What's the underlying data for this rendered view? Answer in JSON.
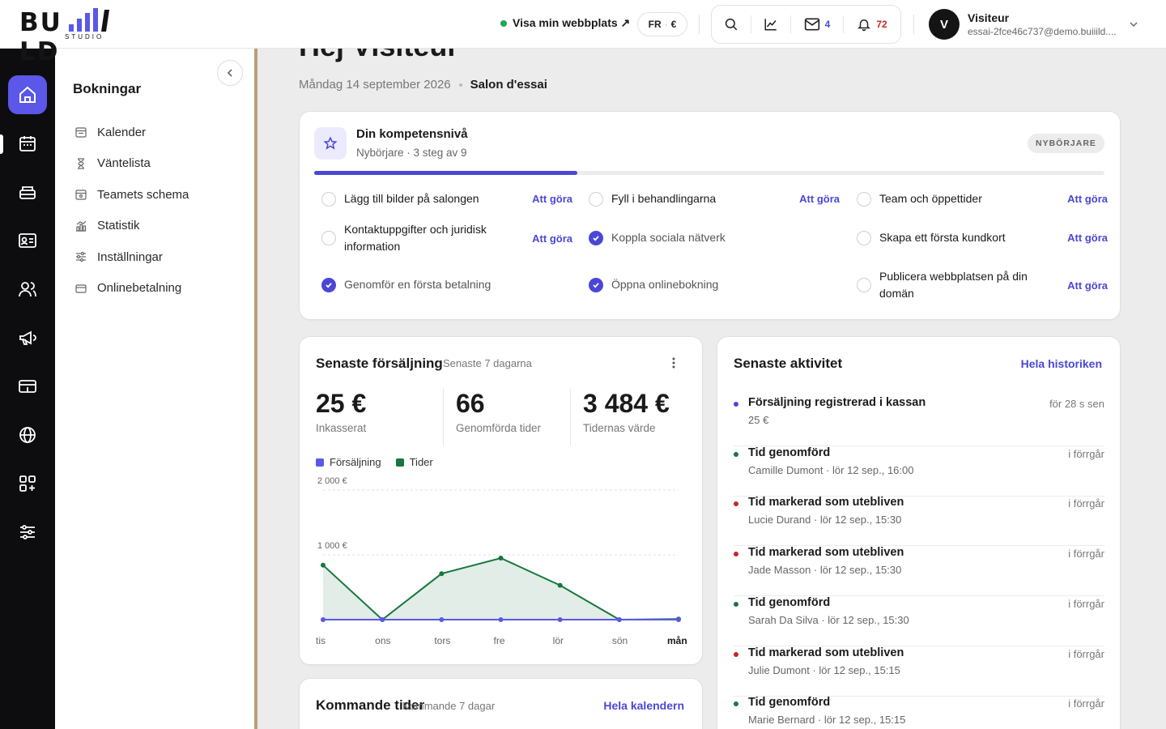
{
  "colors": {
    "accent": "#5b57e8",
    "progress": "#4b47d6",
    "sales_series": "#5b57e8",
    "appointments_series": "#17773f",
    "cancel_dot": "#c8242c",
    "ok_dot": "#17773f",
    "info_dot": "#4b47d6"
  },
  "logo": {
    "text": "BU LD",
    "subtext": "STUDIO"
  },
  "header": {
    "visit_label": "Visa min webbplats ↗",
    "lang": "FR",
    "currency": "€",
    "mail_count": "4",
    "notif_count": "72",
    "user_initial": "V",
    "user_name": "Visiteur",
    "user_email": "essai-2fce46c737@demo.buiiild...."
  },
  "rail": {
    "icons": [
      "home-icon",
      "calendar-icon",
      "register-icon",
      "contact-card-icon",
      "users-icon",
      "megaphone-icon",
      "payment-icon",
      "globe-icon",
      "apps-icon",
      "sliders-icon"
    ]
  },
  "submenu": {
    "title": "Bokningar",
    "items": [
      {
        "label": "Kalender",
        "icon": "calendar-small-icon"
      },
      {
        "label": "Väntelista",
        "icon": "hourglass-icon"
      },
      {
        "label": "Teamets schema",
        "icon": "team-schedule-icon"
      },
      {
        "label": "Statistik",
        "icon": "stats-icon"
      },
      {
        "label": "Inställningar",
        "icon": "settings-icon"
      },
      {
        "label": "Onlinebetalning",
        "icon": "card-icon"
      }
    ]
  },
  "main": {
    "greeting": "Hej Visiteur",
    "date": "Måndag 14 september 2026",
    "salon": "Salon d'essai"
  },
  "skills": {
    "title": "Din kompetensnivå",
    "subtitle": "Nybörjare · 3 steg av 9",
    "badge": "NYBÖRJARE",
    "progress": 0.333,
    "todo_label": "Att göra",
    "tasks": [
      {
        "label": "Lägg till bilder på salongen",
        "done": false
      },
      {
        "label": "Fyll i behandlingarna",
        "done": false
      },
      {
        "label": "Team och öppettider",
        "done": false
      },
      {
        "label": "Kontaktuppgifter och juridisk information",
        "done": false
      },
      {
        "label": "Koppla sociala nätverk",
        "done": true
      },
      {
        "label": "Skapa ett första kundkort",
        "done": false
      },
      {
        "label": "Genomför en första betalning",
        "done": true
      },
      {
        "label": "Öppna onlinebokning",
        "done": true
      },
      {
        "label": "Publicera webbplatsen på din domän",
        "done": false
      }
    ]
  },
  "sales": {
    "title": "Senaste försäljning",
    "subtitle": "Senaste 7 dagarna",
    "kpis": [
      {
        "value": "25 €",
        "label": "Inkasserat"
      },
      {
        "value": "66",
        "label": "Genomförda tider"
      },
      {
        "value": "3 484 €",
        "label": "Tidernas värde"
      }
    ]
  },
  "chart_data": {
    "type": "area",
    "categories": [
      "tis",
      "ons",
      "tors",
      "fre",
      "lör",
      "sön",
      "mån"
    ],
    "series": [
      {
        "name": "Försäljning",
        "values": [
          0,
          0,
          0,
          0,
          0,
          0,
          0
        ]
      },
      {
        "name": "Tider",
        "values": [
          840,
          0,
          710,
          950,
          530,
          0,
          10
        ]
      }
    ],
    "y_ticks": [
      "2 000 €",
      "1 000 €"
    ],
    "ylim": [
      0,
      2000
    ],
    "highlight_category": "mån",
    "grid": true
  },
  "activity": {
    "title": "Senaste aktivitet",
    "link": "Hela historiken",
    "items": [
      {
        "title": "Försäljning registrerad i kassan",
        "sub": "25 €",
        "time": "för 28 s sen",
        "kind": "info"
      },
      {
        "title": "Tid genomförd",
        "sub": "Camille Dumont · lör 12 sep., 16:00",
        "time": "i förrgår",
        "kind": "ok"
      },
      {
        "title": "Tid markerad som utebliven",
        "sub": "Lucie Durand · lör 12 sep., 15:30",
        "time": "i förrgår",
        "kind": "cancel"
      },
      {
        "title": "Tid markerad som utebliven",
        "sub": "Jade Masson · lör 12 sep., 15:30",
        "time": "i förrgår",
        "kind": "cancel"
      },
      {
        "title": "Tid genomförd",
        "sub": "Sarah Da Silva · lör 12 sep., 15:30",
        "time": "i förrgår",
        "kind": "ok"
      },
      {
        "title": "Tid markerad som utebliven",
        "sub": "Julie Dumont · lör 12 sep., 15:15",
        "time": "i förrgår",
        "kind": "cancel"
      },
      {
        "title": "Tid genomförd",
        "sub": "Marie Bernard · lör 12 sep., 15:15",
        "time": "i förrgår",
        "kind": "ok"
      }
    ]
  },
  "upcoming": {
    "title": "Kommande tider",
    "subtitle": "Kommande 7 dagar",
    "link": "Hela kalendern"
  }
}
